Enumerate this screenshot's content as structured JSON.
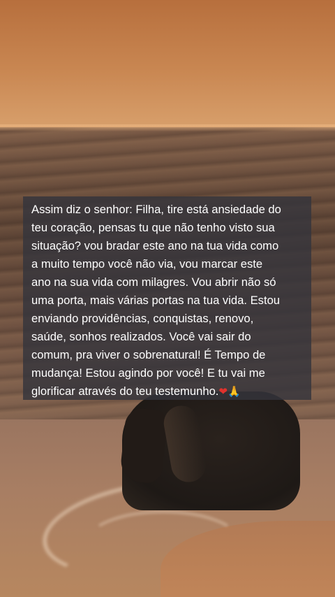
{
  "overlay": {
    "lines": [
      "Assim diz o senhor: Filha, tire está ansiedade do",
      "teu coração, pensas tu que não tenho visto sua",
      "situação? vou bradar este ano na tua vida como",
      "a muito tempo você não via, vou marcar este",
      "ano na sua vida com milagres. Vou abrir não só",
      "uma porta, mais várias portas na tua vida. Estou",
      "enviando providências, conquistas, renovo,",
      "saúde, sonhos realizados. Você vai sair do",
      "comum, pra viver o sobrenatural! É Tempo de",
      "mudança! Estou agindo por você! E tu vai me",
      "glorificar através do teu testemunho."
    ],
    "emoji_heart": "❤",
    "emoji_hands": "🙏"
  },
  "colors": {
    "overlay_background": "#34343c",
    "text": "#ffffff",
    "sky": "#c98752",
    "sand": "#b7875f"
  },
  "background_scene": "woman-kneeling-at-seashore-sunset"
}
